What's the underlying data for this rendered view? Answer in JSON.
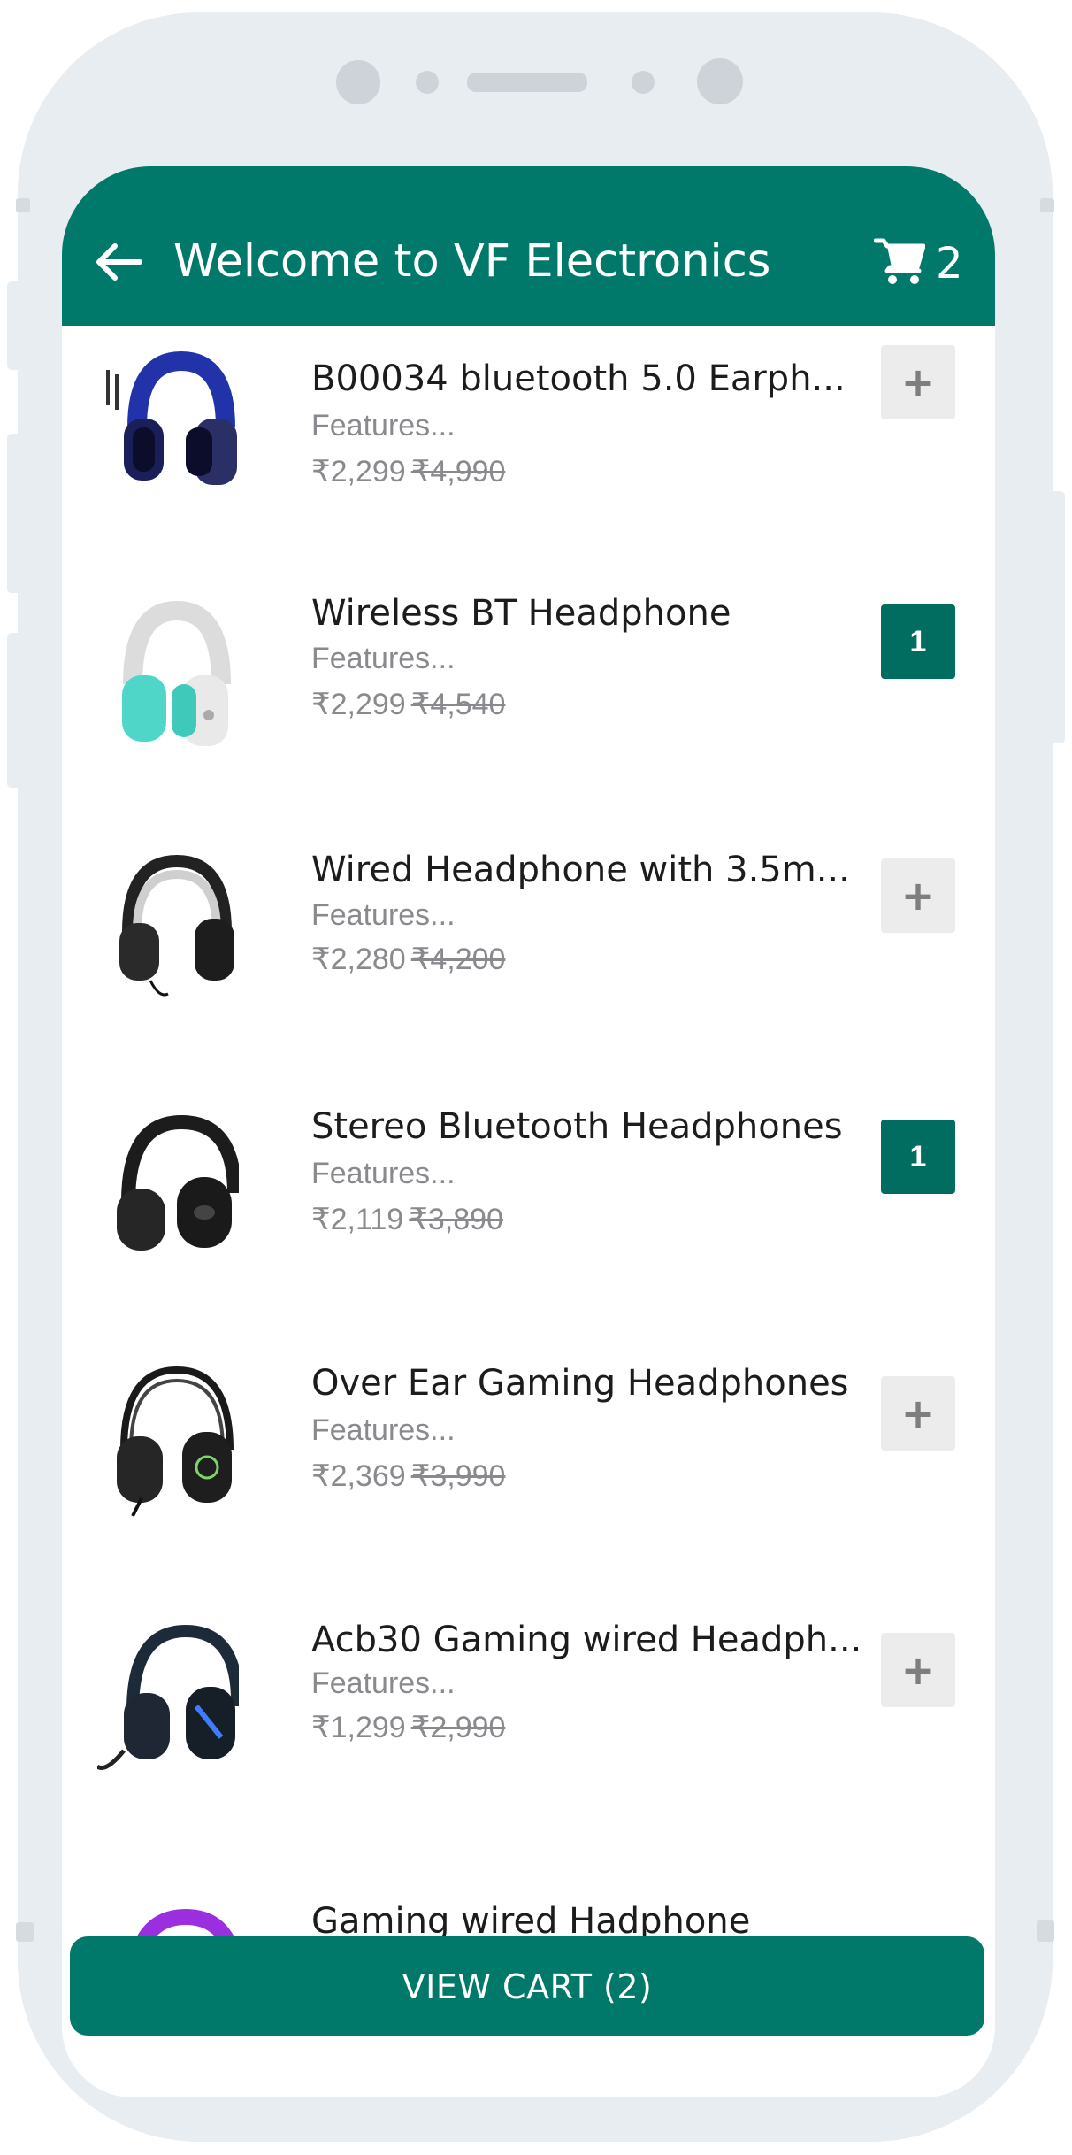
{
  "header": {
    "title": "Welcome to VF Electronics",
    "cart_count": "2",
    "accent_color": "#00796b"
  },
  "products": [
    {
      "name": "B00034 bluetooth 5.0 Earph...",
      "features": "Features...",
      "price": "₹2,299",
      "mrp": "₹4,990",
      "action": "+"
    },
    {
      "name": "Wireless BT Headphone",
      "features": "Features...",
      "price": "₹2,299",
      "mrp": "₹4,540",
      "action": "1"
    },
    {
      "name": "Wired Headphone with 3.5m...",
      "features": "Features...",
      "price": "₹2,280",
      "mrp": "₹4,200",
      "action": "+"
    },
    {
      "name": "Stereo Bluetooth Headphones",
      "features": "Features...",
      "price": "₹2,119",
      "mrp": "₹3,890",
      "action": "1"
    },
    {
      "name": "Over Ear Gaming Headphones",
      "features": "Features...",
      "price": "₹2,369",
      "mrp": "₹3,990",
      "action": "+"
    },
    {
      "name": "Acb30 Gaming wired Headph...",
      "features": "Features...",
      "price": "₹1,299",
      "mrp": "₹2,990",
      "action": "+"
    },
    {
      "name": "Gaming wired Hadphone"
    }
  ],
  "footer": {
    "view_cart_label": "VIEW CART (2)"
  },
  "icons": [
    "back-arrow-icon",
    "cart-icon",
    "plus-icon"
  ]
}
